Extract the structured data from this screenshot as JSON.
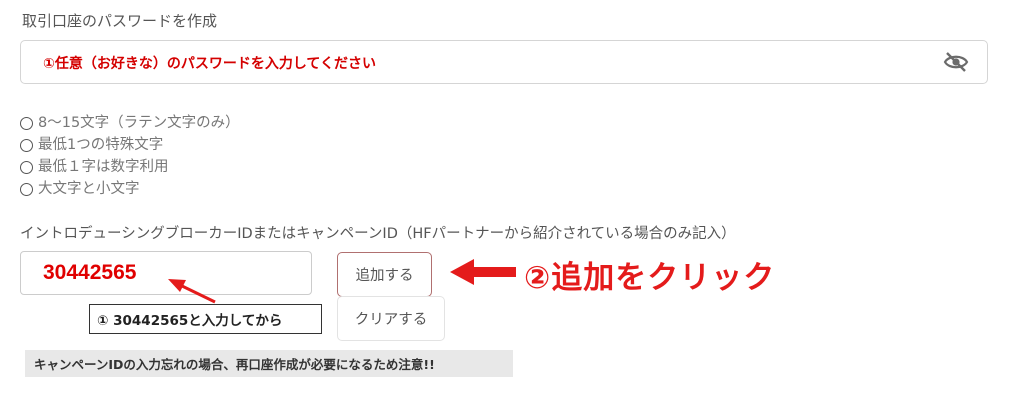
{
  "section": {
    "title": "取引口座のパスワードを作成"
  },
  "password": {
    "value": "①任意（お好きな）のパスワードを入力してください",
    "toggle_icon": "eye-off-icon"
  },
  "requirements": [
    "8〜15文字（ラテン文字のみ）",
    "最低1つの特殊文字",
    "最低１字は数字利用",
    "大文字と小文字"
  ],
  "ib": {
    "label": "イントロデューシングブローカーIDまたはキャンペーンID（HFパートナーから紹介されている場合のみ記入）",
    "value": "30442565",
    "add_label": "追加する",
    "clear_label": "クリアする"
  },
  "annotations": {
    "add": "②追加をクリック",
    "note": "① 30442565と入力してから",
    "warning": "キャンペーンIDの入力忘れの場合、再口座作成が必要になるため注意!!"
  },
  "colors": {
    "annotation": "#e41b1b",
    "input_value": "#e00000"
  }
}
